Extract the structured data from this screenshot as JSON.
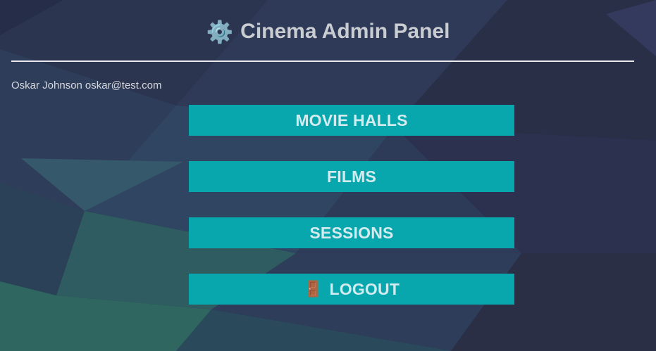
{
  "header": {
    "title_icon": "gear-icon",
    "title_icon_glyph": "⚙️",
    "title": "Cinema Admin Panel"
  },
  "user": {
    "name": "Oskar Johnson",
    "email": "oskar@test.com"
  },
  "menu": {
    "movie_halls": "MOVIE HALLS",
    "films": "FILMS",
    "sessions": "SESSIONS",
    "logout": "LOGOUT",
    "logout_icon": "door-icon",
    "logout_icon_glyph": "🚪"
  },
  "colors": {
    "button_bg": "#08a7ad",
    "button_text": "#d3ebee",
    "title_text": "#c9cdd2",
    "divider": "#e8e8ee",
    "background": "#2a3350"
  }
}
